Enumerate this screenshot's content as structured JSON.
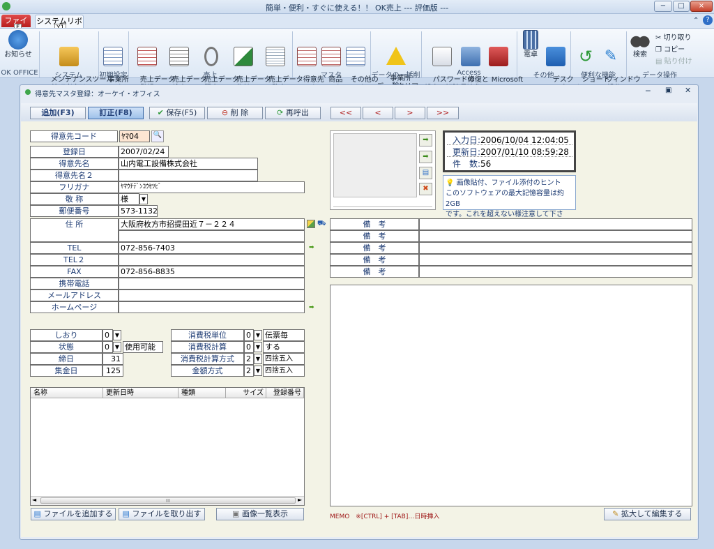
{
  "app": {
    "title": "簡単・便利・すぐに使える！！ OK売上 --- 評価版 ---",
    "window_buttons": [
      "−",
      "□",
      "×"
    ]
  },
  "ribbon": {
    "tabs": [
      "ファイル",
      "システムリボン"
    ],
    "key_tips": [
      "F",
      "Y1"
    ],
    "buttons": [
      {
        "label": "お知らせ",
        "icon": "info-icon"
      },
      {
        "label": "メンテナンスツール\n(管理者向け)",
        "icon": "tools-icon"
      },
      {
        "label": "事業所\nマスタ",
        "icon": "office-master-icon"
      },
      {
        "label": "売上データ\n登録",
        "icon": "sales-register-icon"
      },
      {
        "label": "売上データ\n検索",
        "icon": "sales-search-icon"
      },
      {
        "label": "売上データ\n照会",
        "icon": "sales-inquiry-icon"
      },
      {
        "label": "売上データ\n集計",
        "icon": "sales-aggregate-icon"
      },
      {
        "label": "売上データ\n一覧表",
        "icon": "sales-list-icon"
      },
      {
        "label": "得意先\nマスタ",
        "icon": "customer-master-icon"
      },
      {
        "label": "商品\nマスタ",
        "icon": "product-master-icon"
      },
      {
        "label": "その他の\nマスタ",
        "icon": "other-master-icon"
      },
      {
        "label": "事業所\nデータクリア",
        "icon": "warning-icon"
      },
      {
        "label": "パスワードの\n設定と解除",
        "icon": "password-icon"
      },
      {
        "label": "修復と\n最適化",
        "icon": "repair-icon"
      },
      {
        "label": "Microsoft\nAccess",
        "icon": "access-icon"
      },
      {
        "label": "電卓",
        "icon": "calculator-icon"
      },
      {
        "label": "デスク\nトップへ",
        "icon": "desktop-icon"
      },
      {
        "label": "ショート\nカット",
        "icon": "shortcut-icon"
      },
      {
        "label": "ウィンドウ\nの操作",
        "icon": "pin-icon"
      },
      {
        "label": "検索",
        "icon": "binoculars-icon"
      }
    ],
    "small_buttons": [
      "切り取り",
      "コピー",
      "貼り付け"
    ],
    "groups": [
      "OK OFFICE",
      "システム",
      "初期設定",
      "売上",
      "マスタ",
      "データの一括削除",
      "Access",
      "その他",
      "便利な機能",
      "データ操作"
    ]
  },
  "form": {
    "title": "得意先マスタ登録：オーケイ・オフィス",
    "toolbar": {
      "add": "追加(F3)",
      "edit": "訂正(F8)",
      "save": "保存(F5)",
      "delete": "削 除",
      "recall": "再呼出",
      "first": "<<",
      "prev": "<",
      "next": ">",
      "last": ">>"
    },
    "fields": {
      "code_label": "得意先コード",
      "code": "ﾔﾏ04",
      "reg_date_label": "登録日",
      "reg_date": "2007/02/24",
      "name_label": "得意先名",
      "name": "山内電工設備株式会社",
      "name2_label": "得意先名２",
      "name2": "",
      "kana_label": "フリガナ",
      "kana": "ﾔﾏｳﾁﾃﾞﾝｺｳｾﾂﾋﾞ",
      "honorific_label": "敬 称",
      "honorific": "様",
      "zip_label": "郵便番号",
      "zip": "573-1132",
      "address_label": "住 所",
      "address": "大阪府枚方市招提田近７－２２４",
      "address2": "",
      "tel_label": "TEL",
      "tel": "072-856-7403",
      "tel2_label": "TEL２",
      "tel2": "",
      "fax_label": "FAX",
      "fax": "072-856-8835",
      "mobile_label": "携帯電話",
      "mobile": "",
      "mail_label": "メールアドレス",
      "mail": "",
      "homepage_label": "ホームページ",
      "homepage": ""
    },
    "lower_left": {
      "bookmark_label": "しおり",
      "bookmark": "0",
      "status_label": "状態",
      "status": "0",
      "status_text": "使用可能",
      "closing_label": "締日",
      "closing": "31",
      "collection_label": "集金日",
      "collection": "125"
    },
    "tax": {
      "unit_label": "消費税単位",
      "unit": "0",
      "unit_text": "伝票毎",
      "calc_label": "消費税計算",
      "calc": "0",
      "calc_text": "する",
      "method_label": "消費税計算方式",
      "method": "2",
      "method_text": "四捨五入",
      "amount_label": "金額方式",
      "amount": "2",
      "amount_text": "四捨五入"
    },
    "info_box": {
      "input_date_label": "入力日:",
      "input_date": "2006/10/04 12:04:05",
      "updated_label": "更新日:",
      "updated": "2007/01/10 08:59:28",
      "count_label": "件　数:",
      "count": "56"
    },
    "hint": {
      "title": "画像貼付、ファイル添付のヒント",
      "body1": "このソフトウェアの最大記憶容量は約2GB",
      "body2": "です。これを超えない様注意して下さい。"
    },
    "remarks_label": "備　考",
    "remarks": [
      "",
      "",
      "",
      "",
      ""
    ],
    "file_grid": {
      "headers": [
        "名称",
        "更新日時",
        "種類",
        "サイズ",
        "登録番号"
      ],
      "scroll_mid": "III"
    },
    "bottom_buttons": {
      "add_file": "ファイルを追加する",
      "extract_file": "ファイルを取り出す",
      "image_list": "画像一覧表示",
      "expand_edit": "拡大して編集する"
    },
    "memo_hint": "MEMO　※[CTRL] + [TAB]…日時挿入"
  },
  "colors": {
    "accent": "#1d3b73",
    "file_tab": "#c72a2a",
    "ribbon_bg": "#dde8f5"
  }
}
